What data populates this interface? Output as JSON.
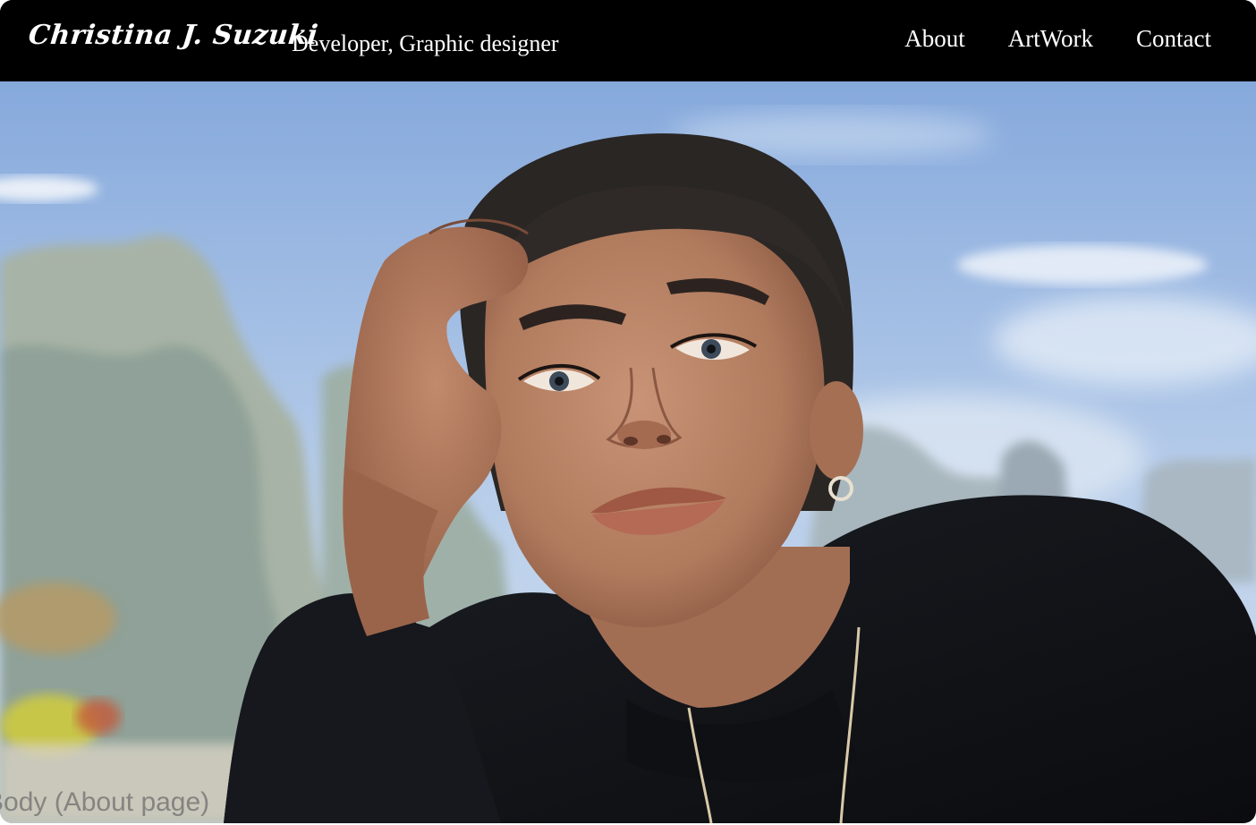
{
  "header": {
    "brand": "Christina J. Suzuki",
    "tagline": "Developer, Graphic designer",
    "nav": [
      {
        "label": "About"
      },
      {
        "label": "ArtWork"
      },
      {
        "label": "Contact"
      }
    ]
  },
  "hero": {
    "image": "painted-portrait",
    "caption": "Body (About page)"
  },
  "colors": {
    "header_bg": "#000000",
    "header_text": "#ffffff",
    "sky_top": "#8fb1e0",
    "sky_bottom": "#cfe0f4",
    "skin": "#c08b6c",
    "shirt": "#121418",
    "hair": "#2a2624"
  }
}
